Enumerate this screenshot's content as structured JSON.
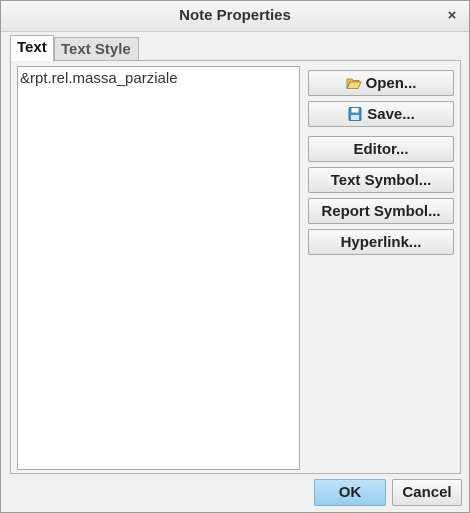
{
  "window": {
    "title": "Note Properties",
    "close_glyph": "×"
  },
  "tabs": [
    {
      "label": "Text",
      "active": true
    },
    {
      "label": "Text Style",
      "active": false
    }
  ],
  "editor": {
    "value": "&rpt.rel.massa_parziale"
  },
  "side_buttons": {
    "open": "Open...",
    "save": "Save...",
    "editor": "Editor...",
    "text_symbol": "Text Symbol...",
    "report_symbol": "Report Symbol...",
    "hyperlink": "Hyperlink..."
  },
  "icons": {
    "open": "folder-open-icon",
    "save": "floppy-disk-icon"
  },
  "footer": {
    "ok": "OK",
    "cancel": "Cancel"
  },
  "colors": {
    "ok_accent": "#a8d8f4"
  }
}
